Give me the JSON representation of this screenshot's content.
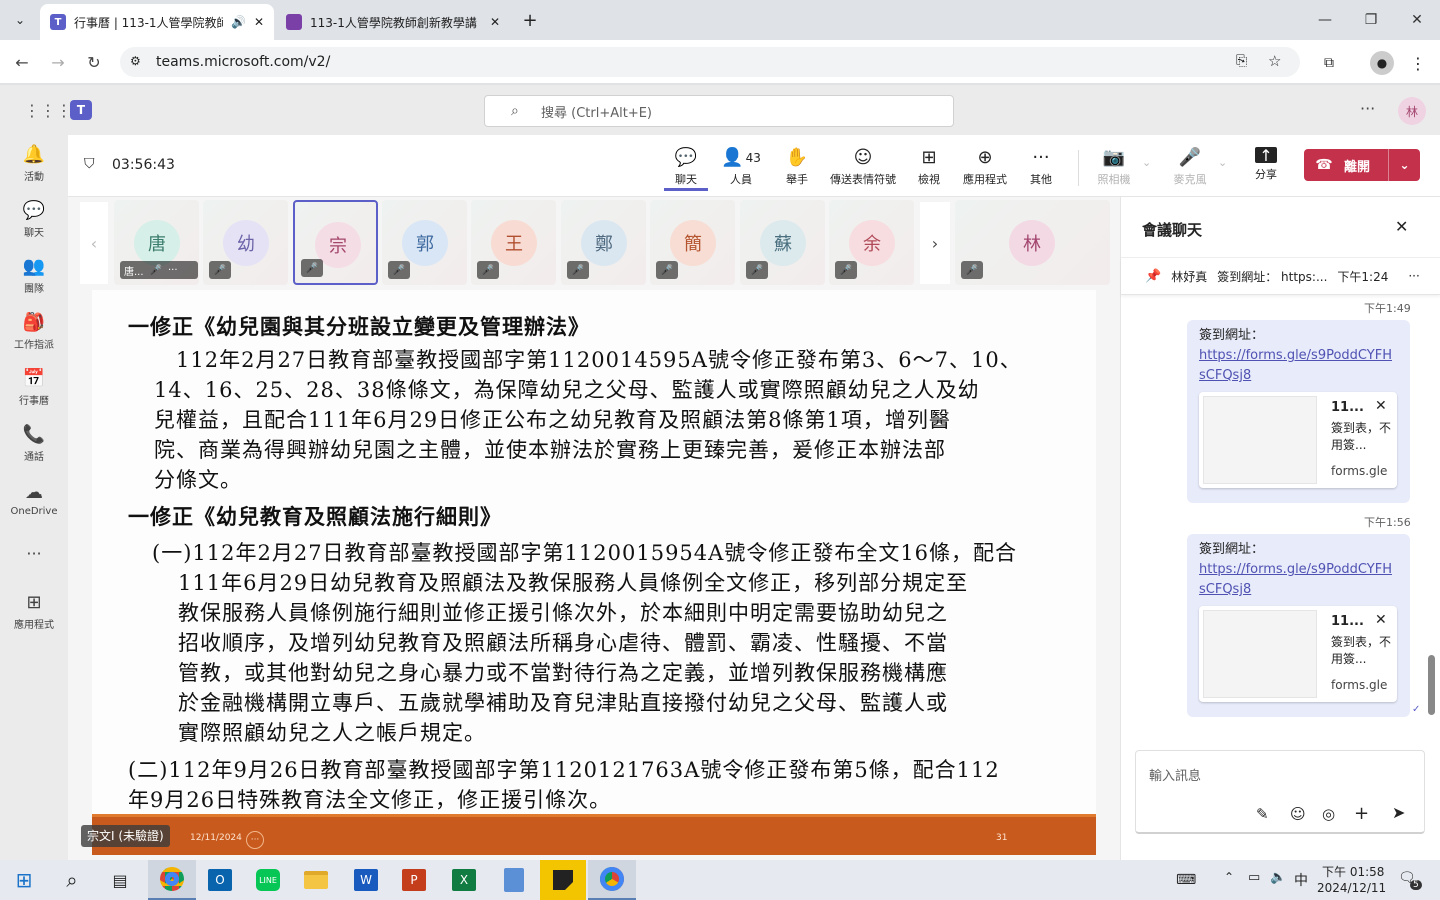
{
  "browser": {
    "tabs": [
      {
        "title": "行事曆 | 113-1人管學院教師",
        "active": true
      },
      {
        "title": "113-1人管學院教師創新教學講",
        "active": false
      }
    ],
    "url": "teams.microsoft.com/v2/"
  },
  "teams": {
    "search_placeholder": "搜尋 (Ctrl+Alt+E)",
    "user_initial": "林",
    "rail": [
      {
        "label": "活動",
        "icon": "bell-icon"
      },
      {
        "label": "聊天",
        "icon": "chat-icon"
      },
      {
        "label": "團隊",
        "icon": "teams-icon"
      },
      {
        "label": "工作指派",
        "icon": "assignments-icon"
      },
      {
        "label": "行事曆",
        "icon": "calendar-icon"
      },
      {
        "label": "通話",
        "icon": "phone-icon"
      },
      {
        "label": "OneDrive",
        "icon": "cloud-icon"
      },
      {
        "label": "",
        "icon": "more-icon"
      },
      {
        "label": "應用程式",
        "icon": "add-app-icon"
      }
    ]
  },
  "meeting": {
    "timer": "03:56:43",
    "toolbar": {
      "chat": "聊天",
      "people": "人員",
      "people_count": "43",
      "raise": "舉手",
      "react": "傳送表情符號",
      "view": "檢視",
      "apps": "應用程式",
      "more": "其他",
      "camera": "照相機",
      "mic": "麥克風",
      "share": "分享",
      "leave": "離開"
    },
    "participants": [
      {
        "name": "唐",
        "label": "唐...",
        "color": "#d6efe8",
        "text": "#3b7d6c"
      },
      {
        "name": "幼",
        "label": "",
        "color": "#e5e2f5",
        "text": "#6b63a8"
      },
      {
        "name": "宗",
        "label": "",
        "color": "#f5dde6",
        "text": "#a4466b",
        "active": true
      },
      {
        "name": "郭",
        "label": "",
        "color": "#d9e6f5",
        "text": "#3e6aa0"
      },
      {
        "name": "王",
        "label": "",
        "color": "#f8dcd3",
        "text": "#b24f30"
      },
      {
        "name": "鄭",
        "label": "",
        "color": "#dbe7f0",
        "text": "#4f6a80"
      },
      {
        "name": "簡",
        "label": "",
        "color": "#f7ddd3",
        "text": "#b4542f"
      },
      {
        "name": "蘇",
        "label": "",
        "color": "#dce9ed",
        "text": "#4a7080"
      },
      {
        "name": "余",
        "label": "",
        "color": "#f7dde0",
        "text": "#b04a58"
      },
      {
        "name": "林",
        "label": "",
        "color": "#f3d9e4",
        "text": "#a3456e"
      }
    ],
    "speaker_label": "宗文I (未驗證)",
    "slide_date": "12/11/2024",
    "slide_page": "31",
    "slide_lines": [
      "一修正《幼兒園與其分班設立變更及管理辦法》",
      "　112年2月27日教育部臺教授國部字第1120014595A號令修正發布第3、6～7、10、",
      "14、16、25、28、38條條文，為保障幼兒之父母、監護人或實際照顧幼兒之人及幼",
      "兒權益，且配合111年6月29日修正公布之幼兒教育及照顧法第8條第1項，增列醫",
      "院、商業為得興辦幼兒園之主體，並使本辦法於實務上更臻完善，爰修正本辦法部",
      "分條文。",
      "一修正《幼兒教育及照顧法施行細則》",
      "(一)112年2月27日教育部臺教授國部字第1120015954A號令修正發布全文16條，配合",
      "111年6月29日幼兒教育及照顧法及教保服務人員條例全文修正，移列部分規定至",
      "教保服務人員條例施行細則並修正援引條次外，於本細則中明定需要協助幼兒之",
      "招收順序，及增列幼兒教育及照顧法所稱身心虐待、體罰、霸凌、性騷擾、不當",
      "管教，或其他對幼兒之身心暴力或不當對待行為之定義，並增列教保服務機構應",
      "於金融機構開立專戶、五歲就學補助及育兒津貼直接撥付幼兒之父母、監護人或",
      "實際照顧幼兒之人之帳戶規定。",
      "(二)112年9月26日教育部臺教授國部字第1120121763A號令修正發布第5條，配合112",
      "年9月26日特殊教育法全文修正，修正援引條次。"
    ]
  },
  "chat": {
    "title": "會議聊天",
    "pinned_author": "林妤真",
    "pinned_text": "簽到網址： https:...",
    "pinned_time": "下午1:24",
    "messages": [
      {
        "time": "下午1:49",
        "prefix": "簽到網址：",
        "link": "https://forms.gle/s9PoddCYFHsCFQsj8",
        "card_title": "11...",
        "card_desc": "簽到表，不用簽...",
        "card_domain": "forms.gle"
      },
      {
        "time": "下午1:56",
        "prefix": "簽到網址：",
        "link": "https://forms.gle/s9PoddCYFHsCFQsj8",
        "card_title": "11...",
        "card_desc": "簽到表，不用簽...",
        "card_domain": "forms.gle"
      }
    ],
    "input_placeholder": "輸入訊息"
  },
  "taskbar": {
    "ime": "中",
    "time": "下午 01:58",
    "date": "2024/12/11",
    "notifications": "5"
  }
}
